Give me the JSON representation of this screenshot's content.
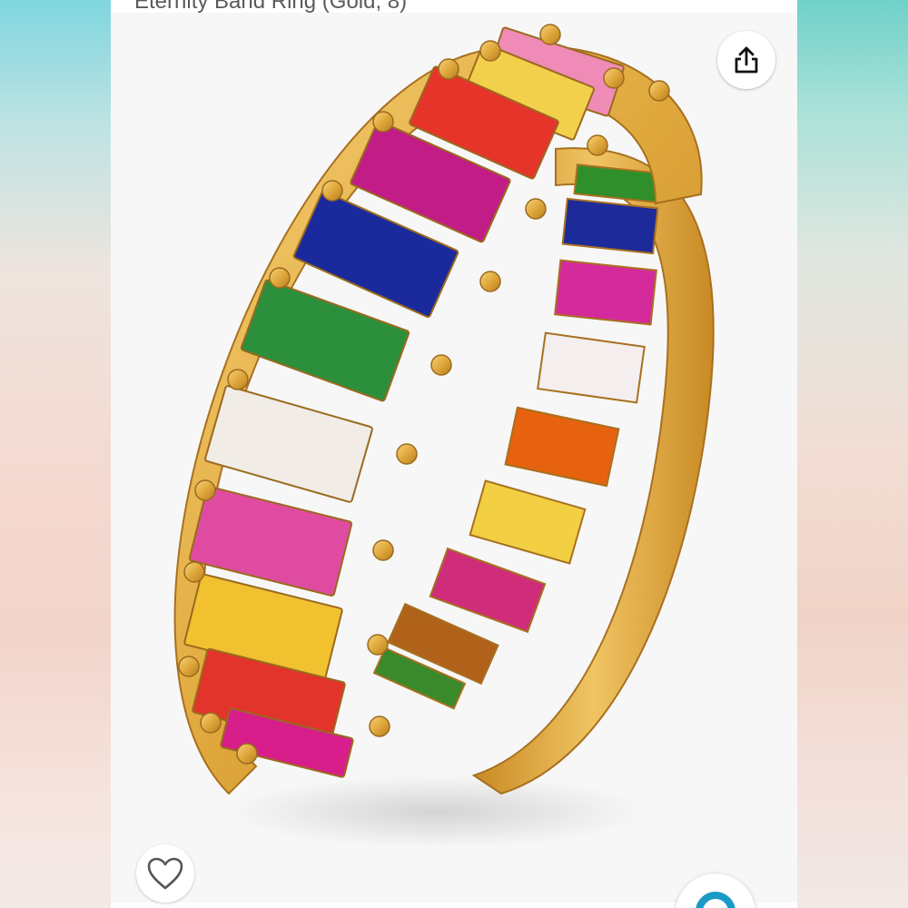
{
  "product": {
    "title_partial": "Eternity Band Ring (Gold, 8)",
    "image_alt": "Rainbow baguette eternity band ring in gold setting"
  },
  "icons": {
    "share": "share-icon",
    "wishlist": "heart-icon",
    "visual_search": "lens-search-icon"
  },
  "colors": {
    "gold": "#e0a83c",
    "lens_accent": "#1a9bc7"
  }
}
